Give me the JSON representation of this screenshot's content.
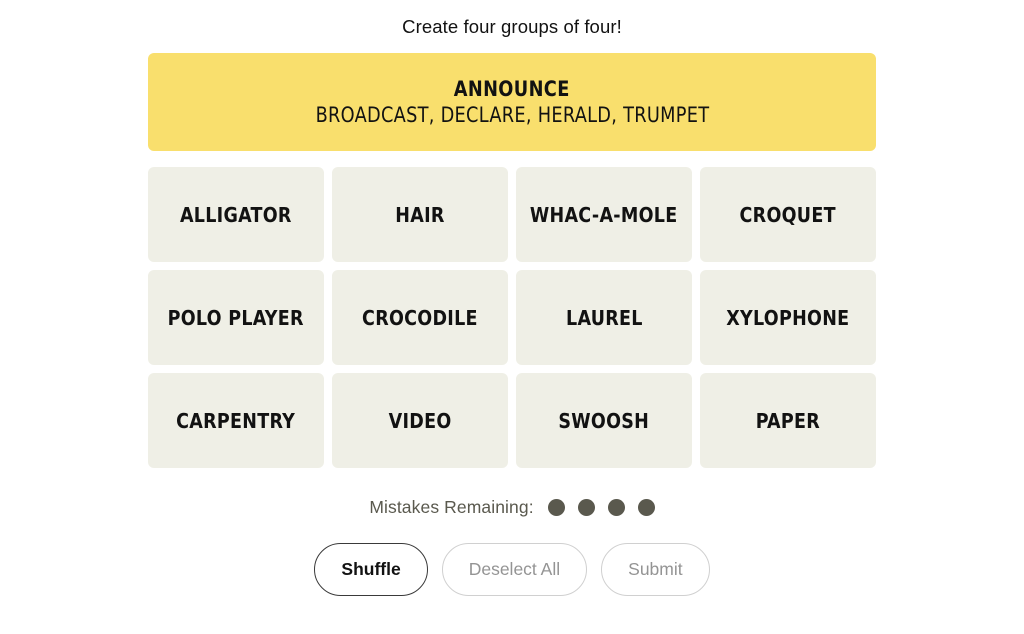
{
  "header": {
    "instruction": "Create four groups of four!"
  },
  "board": {
    "solved_groups": [
      {
        "category": "ANNOUNCE",
        "members_text": "BROADCAST, DECLARE, HERALD, TRUMPET",
        "members": [
          "BROADCAST",
          "DECLARE",
          "HERALD",
          "TRUMPET"
        ],
        "color": "#f9df6d",
        "difficulty": "yellow"
      }
    ],
    "rows": [
      {
        "tiles": [
          {
            "label": "ALLIGATOR",
            "selected": false
          },
          {
            "label": "HAIR",
            "selected": false
          },
          {
            "label": "WHAC-A-MOLE",
            "selected": false
          },
          {
            "label": "CROQUET",
            "selected": false
          }
        ]
      },
      {
        "tiles": [
          {
            "label": "POLO PLAYER",
            "selected": false
          },
          {
            "label": "CROCODILE",
            "selected": false
          },
          {
            "label": "LAUREL",
            "selected": false
          },
          {
            "label": "XYLOPHONE",
            "selected": false
          }
        ]
      },
      {
        "tiles": [
          {
            "label": "CARPENTRY",
            "selected": false
          },
          {
            "label": "VIDEO",
            "selected": false
          },
          {
            "label": "SWOOSH",
            "selected": false
          },
          {
            "label": "PAPER",
            "selected": false
          }
        ]
      }
    ],
    "tile_color": "#efefe6"
  },
  "mistakes": {
    "label": "Mistakes Remaining:",
    "remaining": 4,
    "dots": [
      1,
      2,
      3,
      4
    ],
    "dot_color": "#5a594e"
  },
  "actions": {
    "shuffle": {
      "label": "Shuffle",
      "enabled": true
    },
    "deselect": {
      "label": "Deselect All",
      "enabled": false
    },
    "submit": {
      "label": "Submit",
      "enabled": false
    }
  }
}
